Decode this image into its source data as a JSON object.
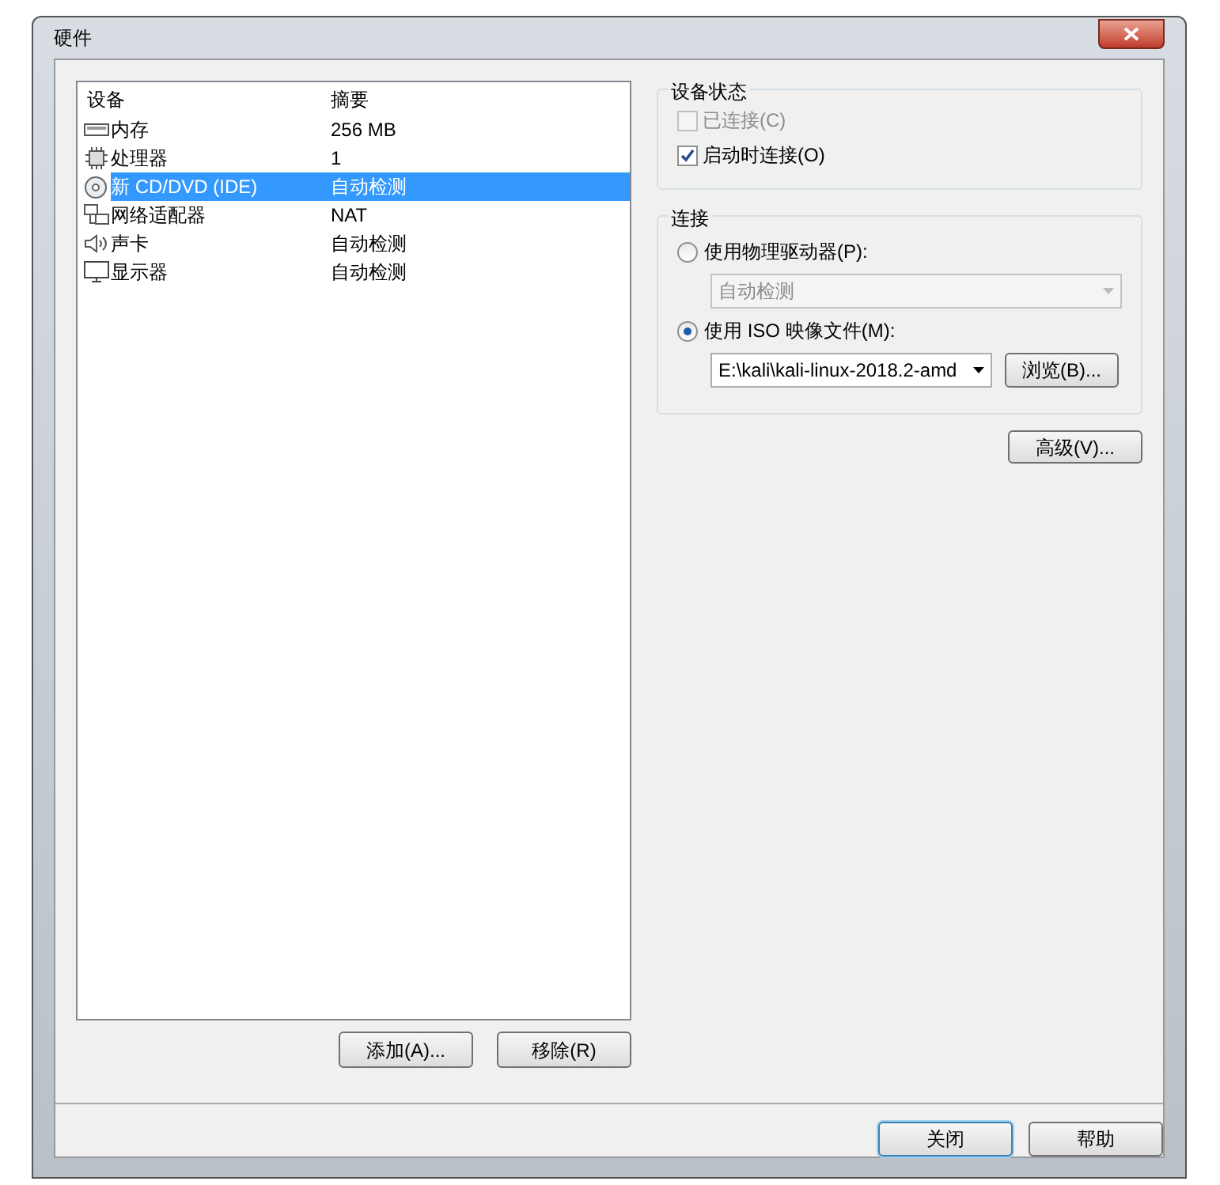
{
  "window": {
    "title": "硬件"
  },
  "devices": {
    "columns": [
      "设备",
      "摘要"
    ],
    "rows": [
      {
        "kind": "memory",
        "name": "内存",
        "summary": "256 MB",
        "selected": false
      },
      {
        "kind": "cpu",
        "name": "处理器",
        "summary": "1",
        "selected": false
      },
      {
        "kind": "cdrom",
        "name": "新 CD/DVD (IDE)",
        "summary": "自动检测",
        "selected": true
      },
      {
        "kind": "network",
        "name": "网络适配器",
        "summary": "NAT",
        "selected": false
      },
      {
        "kind": "sound",
        "name": "声卡",
        "summary": "自动检测",
        "selected": false
      },
      {
        "kind": "display",
        "name": "显示器",
        "summary": "自动检测",
        "selected": false
      }
    ]
  },
  "list_buttons": [
    "添加(A)...",
    "移除(R)"
  ],
  "device_status": {
    "title": "设备状态",
    "options": [
      {
        "label": "已连接(C)",
        "checked": false,
        "disabled": true
      },
      {
        "label": "启动时连接(O)",
        "checked": true,
        "disabled": false
      }
    ]
  },
  "connection": {
    "title": "连接",
    "physical": {
      "label": "使用物理驱动器(P):",
      "selected": false,
      "value": "自动检测",
      "disabled": true
    },
    "iso": {
      "label": "使用 ISO 映像文件(M):",
      "selected": true,
      "value": "E:\\kali\\kali-linux-2018.2-amd",
      "browse": "浏览(B)..."
    }
  },
  "advanced_button": "高级(V)...",
  "footer_buttons": [
    {
      "label": "关闭",
      "default": true
    },
    {
      "label": "帮助",
      "default": false
    }
  ]
}
